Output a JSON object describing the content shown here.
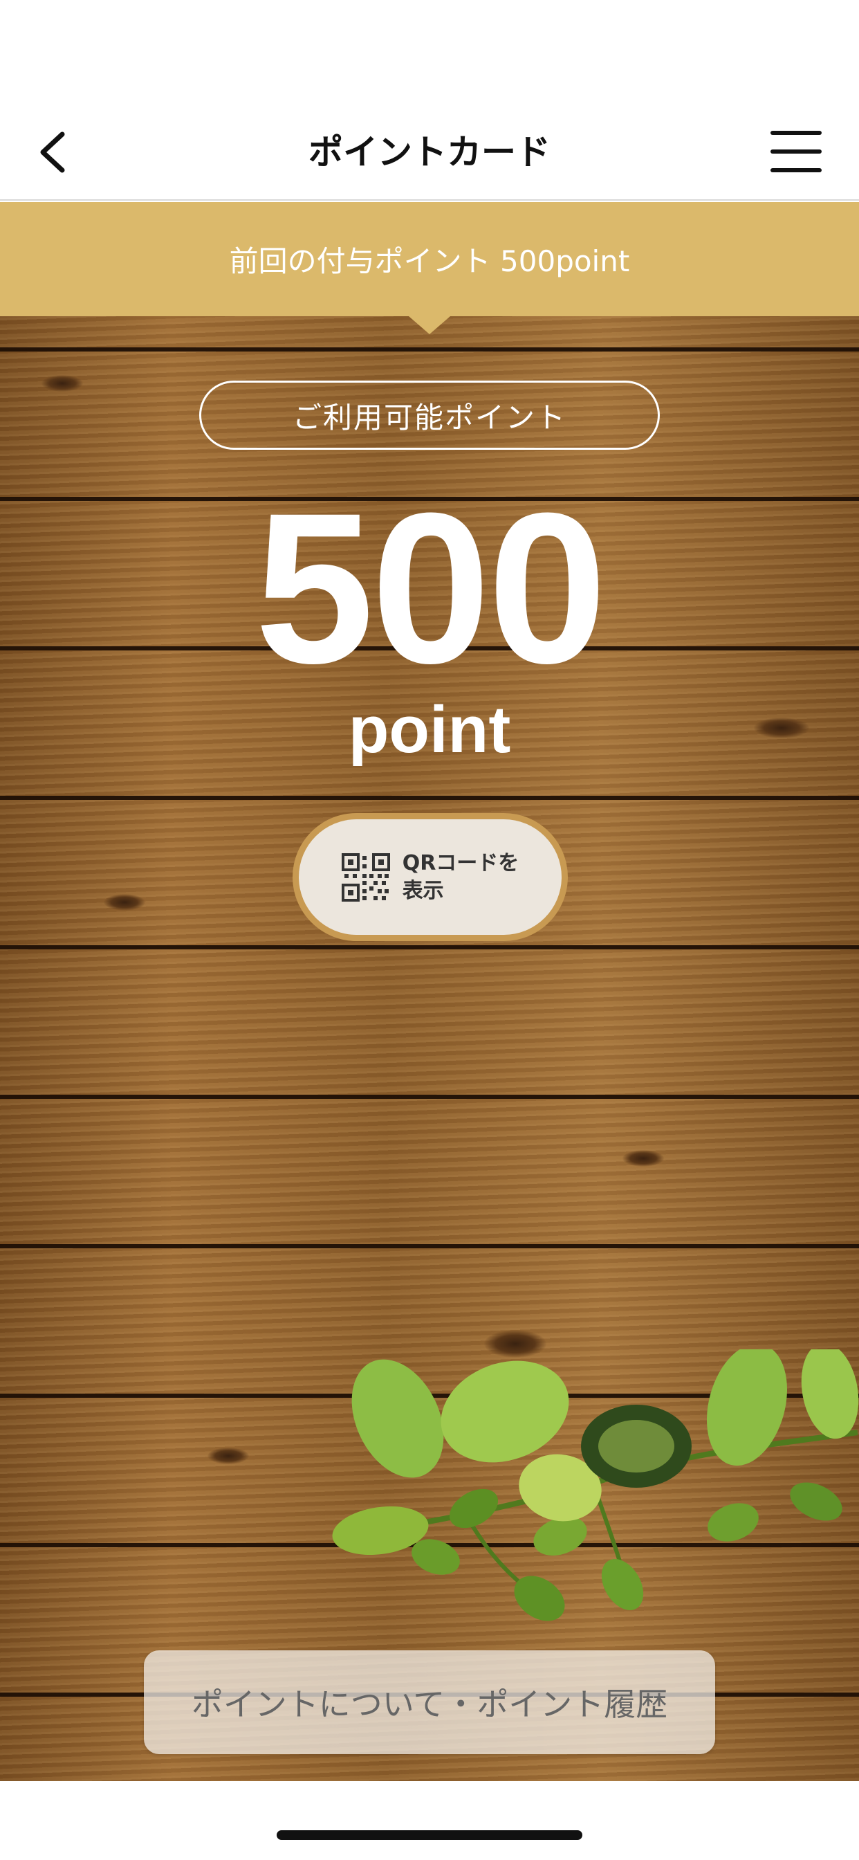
{
  "header": {
    "title": "ポイントカード",
    "back_icon": "chevron-left-icon",
    "menu_icon": "hamburger-menu-icon"
  },
  "banner": {
    "text": "前回の付与ポイント 500point",
    "color": "#dbb96b"
  },
  "points": {
    "label": "ご利用可能ポイント",
    "value": "500",
    "unit": "point"
  },
  "qr_button": {
    "label": "QRコードを\n表示",
    "icon": "qr-code-icon"
  },
  "footer": {
    "link_label": "ポイントについて・ポイント履歴"
  },
  "colors": {
    "accent_gold": "#dbb96b",
    "qr_button_ring": "#c89a52",
    "wood_brown": "#8b5e2c"
  }
}
